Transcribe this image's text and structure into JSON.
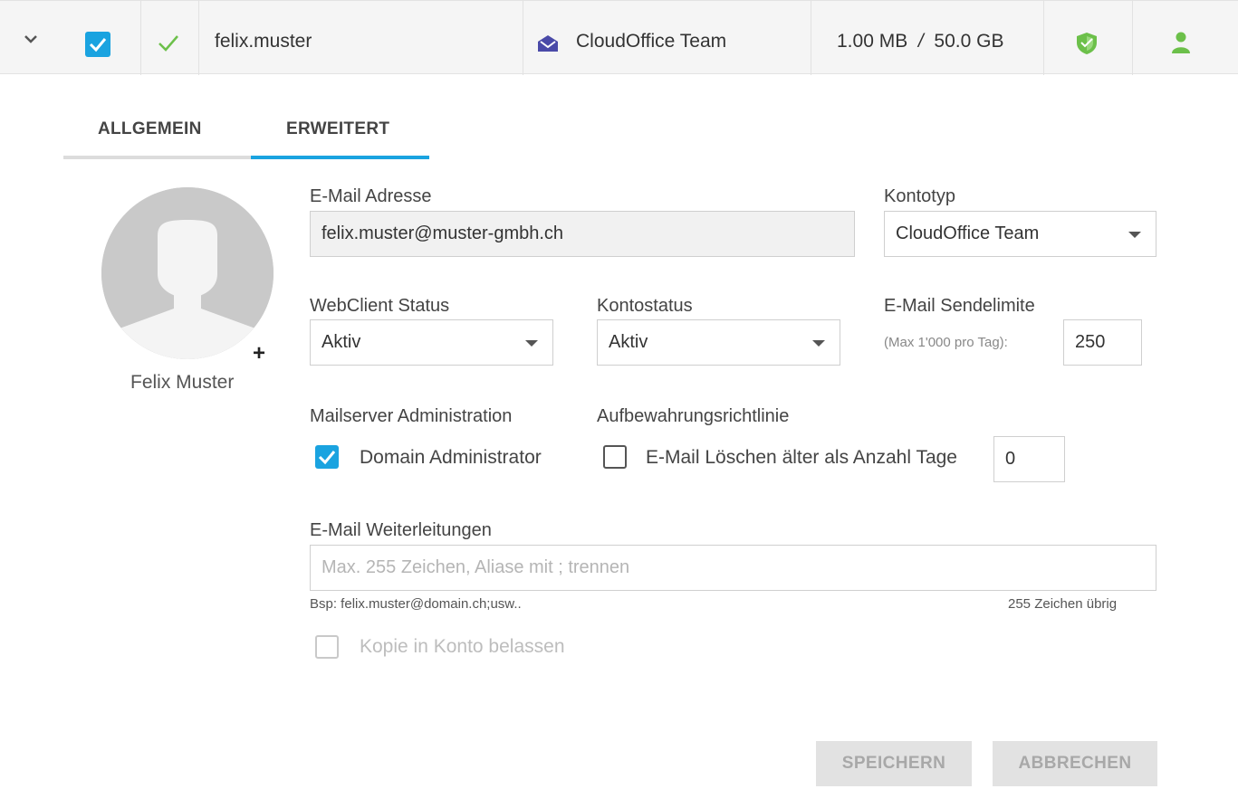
{
  "row": {
    "username": "felix.muster",
    "account_type": "CloudOffice Team",
    "quota_used": "1.00 MB",
    "quota_sep": "/",
    "quota_total": "50.0 GB",
    "colors": {
      "accent": "#1aa3e0",
      "green": "#6cc04a",
      "team_icon": "#4a4aa8"
    },
    "icons": [
      "chevron-down-icon",
      "checkbox-checked-icon",
      "checkmark-icon",
      "envelope-icon",
      "shield-icon",
      "person-icon"
    ]
  },
  "tabs": [
    {
      "label": "ALLGEMEIN",
      "active": false
    },
    {
      "label": "ERWEITERT",
      "active": true
    }
  ],
  "avatar": {
    "name": "Felix Muster",
    "add_symbol": "+"
  },
  "form": {
    "email_label": "E-Mail Adresse",
    "email_value": "felix.muster@muster-gmbh.ch",
    "account_type_label": "Kontotyp",
    "account_type_value": "CloudOffice Team",
    "webclient_label": "WebClient Status",
    "webclient_value": "Aktiv",
    "account_status_label": "Kontostatus",
    "account_status_value": "Aktiv",
    "send_limit_label": "E-Mail Sendelimite",
    "send_limit_hint": "(Max 1'000 pro Tag):",
    "send_limit_value": "250",
    "mailserver_admin_label": "Mailserver Administration",
    "domain_admin_label": "Domain Administrator",
    "domain_admin_checked": true,
    "retention_label": "Aufbewahrungsrichtlinie",
    "retention_checkbox_label": "E-Mail Löschen älter als Anzahl Tage",
    "retention_checked": false,
    "retention_days": "0",
    "forwarding_label": "E-Mail Weiterleitungen",
    "forwarding_placeholder": "Max. 255 Zeichen, Aliase mit ; trennen",
    "forwarding_example": "Bsp: felix.muster@domain.ch;usw..",
    "forwarding_remaining": "255 Zeichen übrig",
    "keep_copy_label": "Kopie in Konto belassen",
    "keep_copy_checked": false
  },
  "buttons": {
    "save": "SPEICHERN",
    "cancel": "ABBRECHEN"
  }
}
